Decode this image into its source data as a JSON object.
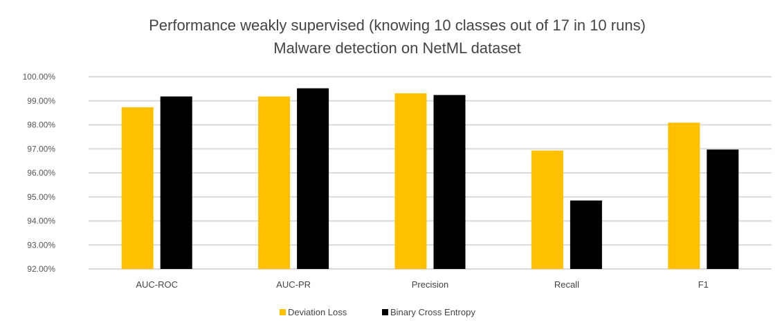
{
  "chart_data": {
    "type": "bar",
    "title": "Performance weakly supervised (knowing 10 classes out of 17 in 10 runs)",
    "subtitle": "Malware detection on NetML dataset",
    "xlabel": "",
    "ylabel": "",
    "ylim": [
      92,
      100
    ],
    "yticks": [
      92,
      93,
      94,
      95,
      96,
      97,
      98,
      99,
      100
    ],
    "ytick_labels": [
      "92.00%",
      "93.00%",
      "94.00%",
      "95.00%",
      "96.00%",
      "97.00%",
      "98.00%",
      "99.00%",
      "100.00%"
    ],
    "grid": true,
    "legend_position": "bottom",
    "categories": [
      "AUC-ROC",
      "AUC-PR",
      "Precision",
      "Recall",
      "F1"
    ],
    "series": [
      {
        "name": "Deviation Loss",
        "color": "#FFC000",
        "values": [
          98.73,
          99.18,
          99.31,
          96.93,
          98.09
        ]
      },
      {
        "name": "Binary Cross Entropy",
        "color": "#000000",
        "values": [
          99.18,
          99.52,
          99.24,
          94.85,
          96.97
        ]
      }
    ]
  }
}
